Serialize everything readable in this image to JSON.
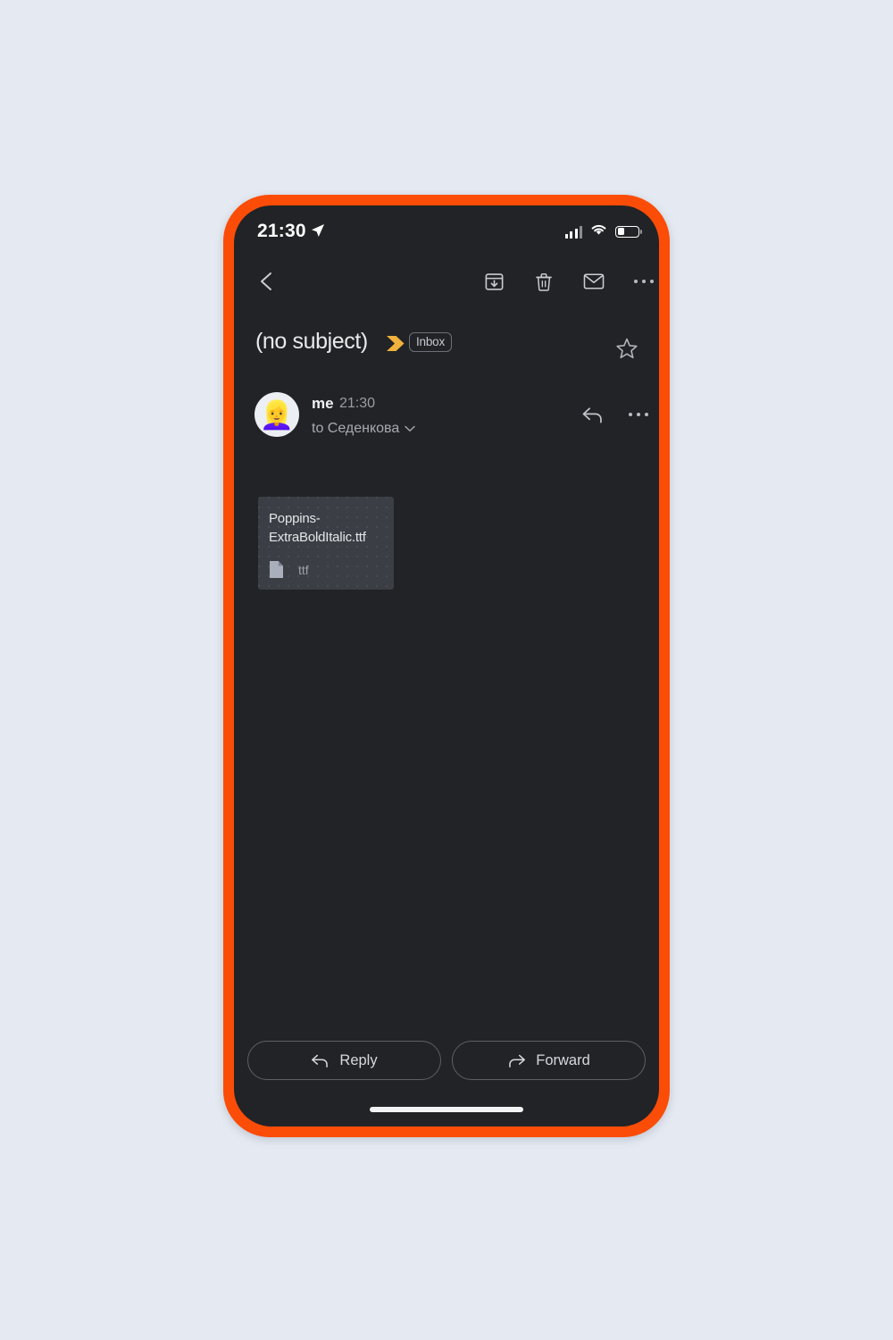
{
  "theme": {
    "frame_color": "#fb4d08",
    "screen_bg": "#222326",
    "page_bg": "#e5eaf2",
    "important_marker_color": "#f0b23c",
    "attachment_card_bg": "#3b3e44",
    "primary_text": "#e9eaec",
    "secondary_text": "#9a9da3"
  },
  "status_bar": {
    "time": "21:30",
    "location_icon": "location-arrow-icon",
    "signal_icon": "cellular-signal-icon",
    "wifi_icon": "wifi-icon",
    "battery_icon": "battery-icon",
    "battery_level_percent": 33
  },
  "action_bar": {
    "back": "back-icon",
    "archive": "archive-icon",
    "delete": "trash-icon",
    "mark_unread": "envelope-icon",
    "more": "more-options-icon"
  },
  "subject": {
    "title": "(no subject)",
    "important_marker": "important-chevron-icon",
    "label": "Inbox",
    "star": "star-outline-icon"
  },
  "message": {
    "avatar_emoji": "👱‍♀️",
    "sender": "me",
    "time": "21:30",
    "recipient": "to Седенкова",
    "recipient_expand_icon": "chevron-down-icon",
    "reply_icon": "reply-arrow-icon",
    "more_icon": "more-options-icon"
  },
  "attachment": {
    "filename": "Poppins-ExtraBoldItalic.ttf",
    "file_icon": "document-icon",
    "type": "ttf"
  },
  "bottom_actions": {
    "reply": {
      "label": "Reply",
      "icon": "reply-arrow-icon"
    },
    "forward": {
      "label": "Forward",
      "icon": "forward-arrow-icon"
    }
  }
}
